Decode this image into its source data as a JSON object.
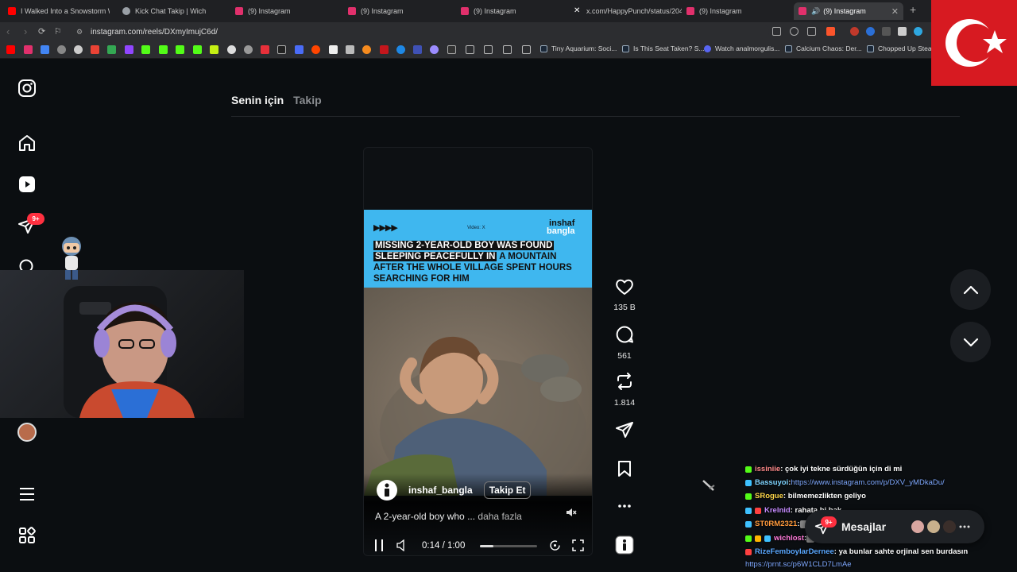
{
  "browser": {
    "tabs": [
      {
        "label": "I Walked Into a Snowstorm Wi",
        "favicon_color": "#ff0000"
      },
      {
        "label": "Kick Chat Takip | Wich",
        "favicon_color": "#9aa0a6"
      },
      {
        "label": "(9) Instagram",
        "favicon_color": "#e1306c"
      },
      {
        "label": "(9) Instagram",
        "favicon_color": "#e1306c"
      },
      {
        "label": "(9) Instagram",
        "favicon_color": "#e1306c"
      },
      {
        "label": "x.com/HappyPunch/status/204",
        "favicon_color": "#ffffff"
      },
      {
        "label": "(9) Instagram",
        "favicon_color": "#e1306c"
      },
      {
        "label": "(9) Instagram",
        "favicon_color": "#e1306c",
        "active": true
      }
    ],
    "url": "instagram.com/reels/DXmyImujC6d/",
    "bookmarks": [
      {
        "label": "Tiny Aquarium: Soci..."
      },
      {
        "label": "Is This Seat Taken? S..."
      },
      {
        "label": "Watch analmorgulis..."
      },
      {
        "label": "Calcium Chaos: Der..."
      },
      {
        "label": "Chopped Up Steam"
      }
    ]
  },
  "sidebar": {
    "notification_badge": "9+"
  },
  "feed": {
    "tab_for_you": "Senin için",
    "tab_following": "Takip"
  },
  "reel": {
    "video_label": "Video: X",
    "brand_line1": "inshaf",
    "brand_line2": "bangla",
    "headline1": "MISSING 2-YEAR-OLD BOY WAS FOUND",
    "headline2a": "SLEEPING PEACEFULLY IN",
    "headline2b": " A MOUNTAIN",
    "headline3": "AFTER THE WHOLE VILLAGE SPENT HOURS",
    "headline4": "SEARCHING FOR HIM",
    "author": "inshaf_bangla",
    "follow_label": "Takip Et",
    "caption": "A 2-year-old boy who ...",
    "caption_more": " daha fazla",
    "timecode": "0:14 / 1:00",
    "progress_fraction": 0.23
  },
  "actions": {
    "likes": "135 B",
    "comments": "561",
    "reposts": "1.814"
  },
  "chat": [
    {
      "user": "issiniie",
      "msg": " : çok iyi tekne sürdüğün için di mi",
      "user_color": "#ff8a8a",
      "badge_color": "#53fc18"
    },
    {
      "user": "Bassuyoi",
      "msg": " : ",
      "link": "https://www.instagram.com/p/DXV_yMDkaDu/",
      "user_color": "#7fd4ff",
      "badge_color": "#3ec1ff"
    },
    {
      "user": "SRogue",
      "msg": " : bilmemezlikten geliyo",
      "user_color": "#ffd84a",
      "badge_color": "#53fc18"
    },
    {
      "user": "Krelnid",
      "msg": " : rahata bi bak",
      "user_color": "#c58bff",
      "badge_color": "#ff4040"
    },
    {
      "user": "ST0RM2321",
      "msg": " : ",
      "user_color": "#ff9a3c",
      "badge_color": "#3ec1ff"
    },
    {
      "user": "wichlost",
      "msg": " : ",
      "user_color": "#ff7ad9",
      "badge_color": "#53fc18"
    },
    {
      "user": "RizeFemboylarDernee",
      "msg": " : ya bunlar sahte orjinal sen burdasın",
      "user_color": "#5aa8ff",
      "badge_color": "#ff4040"
    },
    {
      "user": "",
      "msg": "",
      "link": "https://prnt.sc/p6W1CLD7LmAe",
      "user_color": "#ffffff",
      "badge_color": ""
    }
  ],
  "messages": {
    "label": "Mesajlar",
    "badge": "9+"
  }
}
